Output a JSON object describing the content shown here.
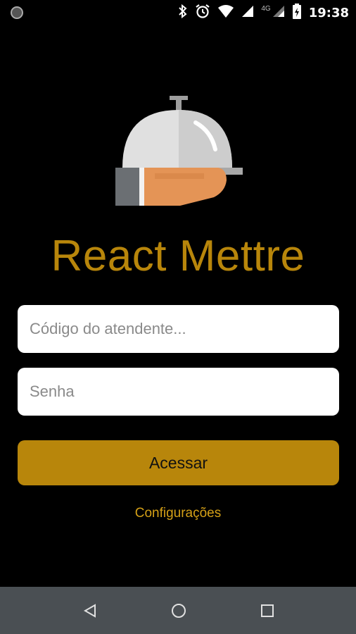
{
  "status_bar": {
    "time": "19:38",
    "network_label": "4G",
    "icons": [
      "notification-dot-icon",
      "bluetooth-icon",
      "alarm-icon",
      "wifi-icon",
      "signal-icon",
      "signal-icon",
      "battery-charging-icon"
    ]
  },
  "app": {
    "title": "React Mettre",
    "logo_icon": "waiter-cloche-icon"
  },
  "login": {
    "user_placeholder": "Código do atendente...",
    "user_value": "",
    "password_placeholder": "Senha",
    "password_value": "",
    "submit_label": "Acessar",
    "settings_link": "Configurações"
  },
  "colors": {
    "background": "#000000",
    "accent": "#b8860b",
    "link": "#d4a017",
    "field_bg": "#ffffff",
    "nav_bar": "#4a4f53"
  },
  "nav_bar": {
    "icons": [
      "back-icon",
      "home-icon",
      "recents-icon"
    ]
  }
}
